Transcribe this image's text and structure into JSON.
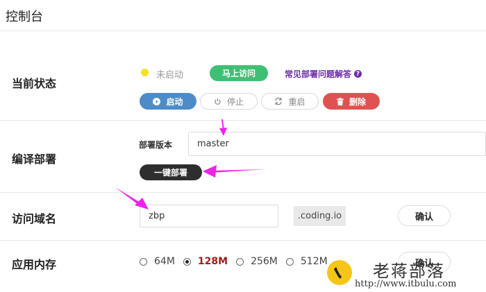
{
  "header": {
    "title": "控制台"
  },
  "status": {
    "section_label": "当前状态",
    "state_text": "未启动",
    "visit_now_label": "马上访问",
    "faq_link": "常见部署问题解答",
    "faq_icon": "?",
    "actions": [
      {
        "label": "启动",
        "icon": "play-icon"
      },
      {
        "label": "停止",
        "icon": "power-icon"
      },
      {
        "label": "重启",
        "icon": "refresh-icon"
      },
      {
        "label": "删除",
        "icon": "trash-icon"
      }
    ]
  },
  "deploy": {
    "section_label": "编译部署",
    "version_label": "部署版本",
    "version_value": "master",
    "one_click_label": "一键部署"
  },
  "domain": {
    "section_label": "访问域名",
    "input_value": "zbp",
    "suffix": ".coding.io",
    "confirm_label": "确认"
  },
  "memory": {
    "section_label": "应用内存",
    "options": [
      "64M",
      "128M",
      "256M",
      "512M"
    ],
    "selected": "128M",
    "confirm_label": "确认"
  },
  "watermark": {
    "name": "老蒋部落",
    "url": "http://www.itbulu.com"
  },
  "colors": {
    "green": "#3fbf74",
    "blue": "#4d8cc7",
    "red": "#e05252",
    "dark": "#2e2e2e",
    "link_purple": "#6a2da8",
    "status_yellow": "#f4e21f",
    "arrow_magenta": "#ee22ee",
    "selected_text": "#9b1c1c"
  }
}
